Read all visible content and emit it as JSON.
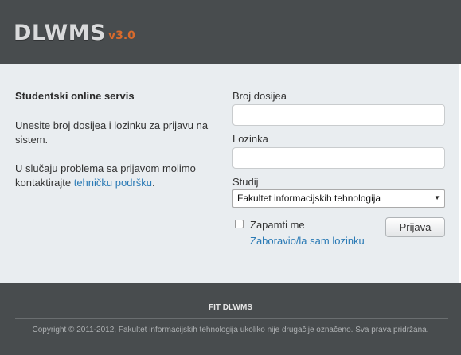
{
  "header": {
    "logo_text": "DLWMS",
    "version": "v3.0"
  },
  "info": {
    "title": "Studentski online servis",
    "text1": "Unesite broj dosijea i lozinku za prijavu na sistem.",
    "text2_prefix": "U slučaju problema sa prijavom molimo kontaktirajte ",
    "text2_link": "tehničku podršku",
    "text2_suffix": "."
  },
  "form": {
    "dosije_label": "Broj dosijea",
    "dosije_value": "",
    "lozinka_label": "Lozinka",
    "lozinka_value": "",
    "studij_label": "Studij",
    "studij_selected": "Fakultet informacijskih tehnologija",
    "remember_label": "Zapamti me",
    "remember_checked": false,
    "forgot_link": "Zaboravio/la sam lozinku",
    "submit_label": "Prijava"
  },
  "footer": {
    "title": "FIT DLWMS",
    "copyright": "Copyright © 2011-2012, Fakultet informacijskih tehnologija ukoliko nije drugačije označeno. Sva prava pridržana."
  },
  "colors": {
    "header_bg": "#484c4e",
    "version_accent": "#d76a2c",
    "link": "#2a7ab5",
    "body_bg": "#e9edf0"
  }
}
